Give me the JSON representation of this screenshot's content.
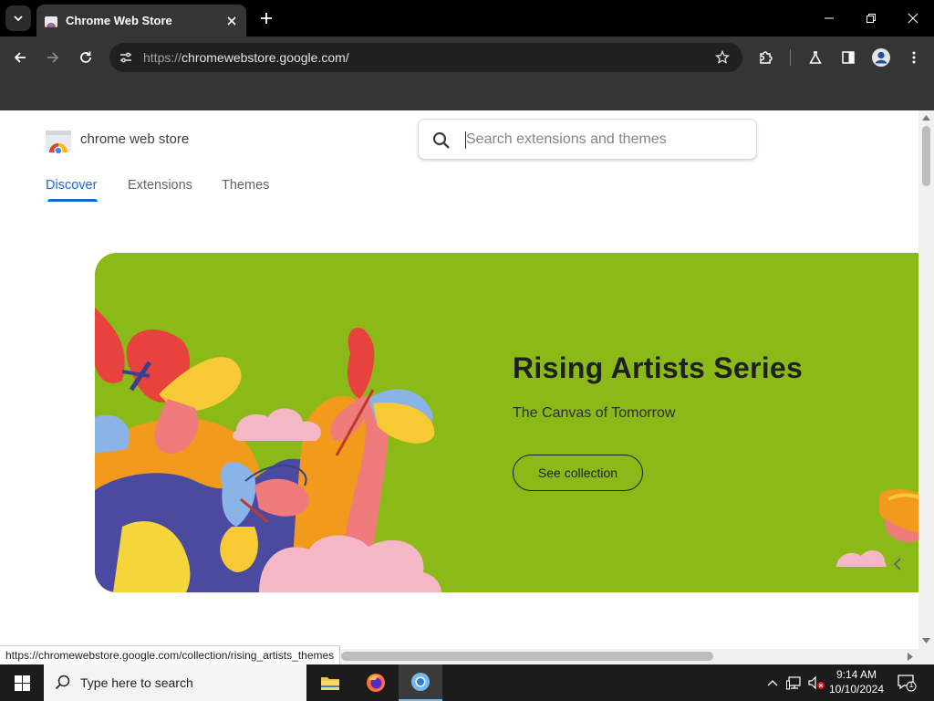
{
  "browser": {
    "tab_title": "Chrome Web Store",
    "url_scheme": "https://",
    "url_host": "chromewebstore.google.com/"
  },
  "store": {
    "brand": "chrome web store",
    "search_placeholder": "Search extensions and themes",
    "nav": [
      "Discover",
      "Extensions",
      "Themes"
    ],
    "active_nav": "Discover"
  },
  "hero": {
    "title": "Rising Artists Series",
    "subtitle": "The Canvas of Tomorrow",
    "button": "See collection",
    "background": "#8bba18"
  },
  "status_url": "https://chromewebstore.google.com/collection/rising_artists_themes",
  "taskbar": {
    "search_placeholder": "Type here to search",
    "time": "9:14 AM",
    "date": "10/10/2024",
    "notification_count": "1"
  },
  "colors": {
    "accent": "#1967d2",
    "chrome_dark": "#353535"
  }
}
